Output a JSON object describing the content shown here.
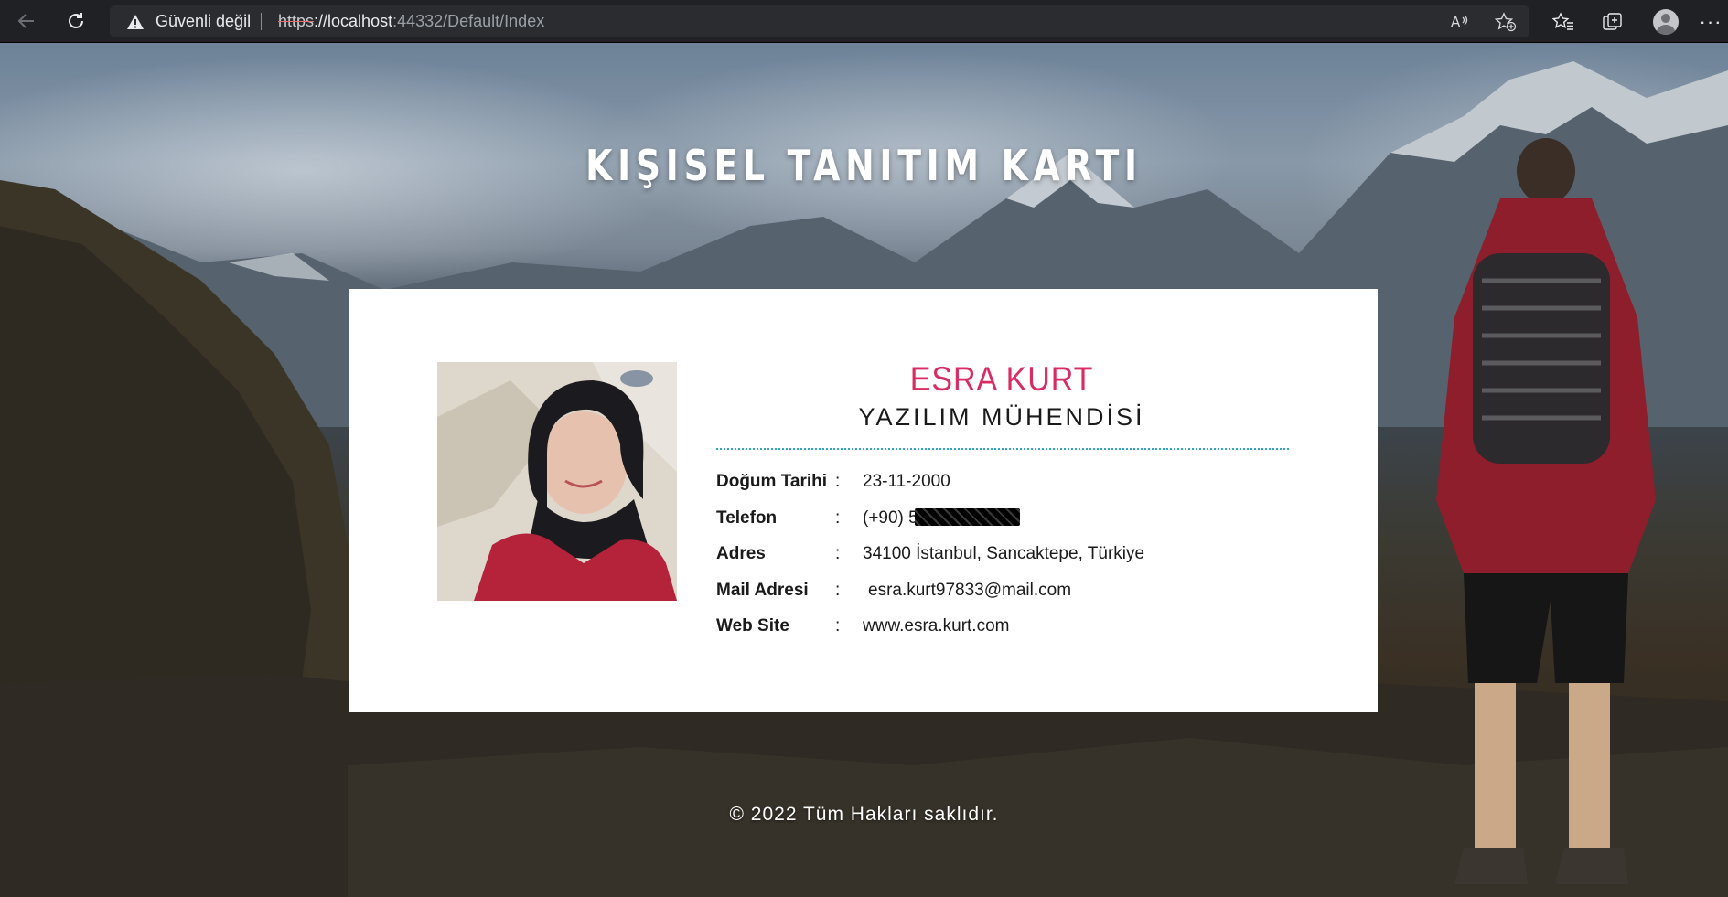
{
  "browser": {
    "security_label": "Güvenli değil",
    "url_scheme": "https",
    "url_host": "://localhost",
    "url_rest": ":44332/Default/Index"
  },
  "page": {
    "heading": "KIŞISEL TANITIM KARTI",
    "profile": {
      "name": "ESRA KURT",
      "title": "YAZILIM MÜHENDİSİ",
      "rows": [
        {
          "label": "Doğum Tarihi",
          "sep": ":",
          "value": "23-11-2000"
        },
        {
          "label": "Telefon",
          "sep": ":",
          "value": "(+90) 5"
        },
        {
          "label": "Adres",
          "sep": ":",
          "value": "34100 İstanbul, Sancaktepe, Türkiye"
        },
        {
          "label": "Mail Adresi",
          "sep": ":",
          "value": "esra.kurt97833@mail.com"
        },
        {
          "label": "Web Site",
          "sep": ":",
          "value": "www.esra.kurt.com"
        }
      ]
    },
    "footer": "© 2022 Tüm Hakları saklıdır."
  },
  "icons": {
    "back": "arrow-left-icon",
    "reload": "reload-icon",
    "security": "warning-triangle-icon",
    "read_aloud": "read-aloud-icon",
    "add_favorite": "star-add-icon",
    "favorites": "favorites-icon",
    "collections": "collections-icon",
    "profile": "profile-avatar-icon",
    "menu": "more-icon"
  },
  "colors": {
    "accent_name": "#d92c63",
    "divider": "#2fa6c8",
    "card_bg": "#ffffff"
  }
}
